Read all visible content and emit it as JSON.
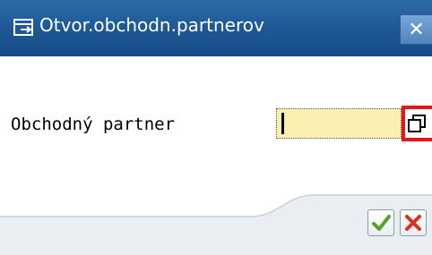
{
  "window": {
    "title": "Otvor.obchodn.partnerov",
    "title_icon": "dialog-icon",
    "close_icon": "close-icon"
  },
  "form": {
    "label": "Obchodný partner",
    "value": "",
    "help_icon": "f4-value-help-icon",
    "help_highlight_color": "#e8141c",
    "input_background": "#fbefb2"
  },
  "footer": {
    "ok_icon": "checkmark-icon",
    "cancel_icon": "cancel-x-icon",
    "ok_color": "#5aa02c",
    "cancel_color": "#d8311b"
  },
  "colors": {
    "titlebar": "#1e5a98",
    "footer": "#e9eef3"
  }
}
